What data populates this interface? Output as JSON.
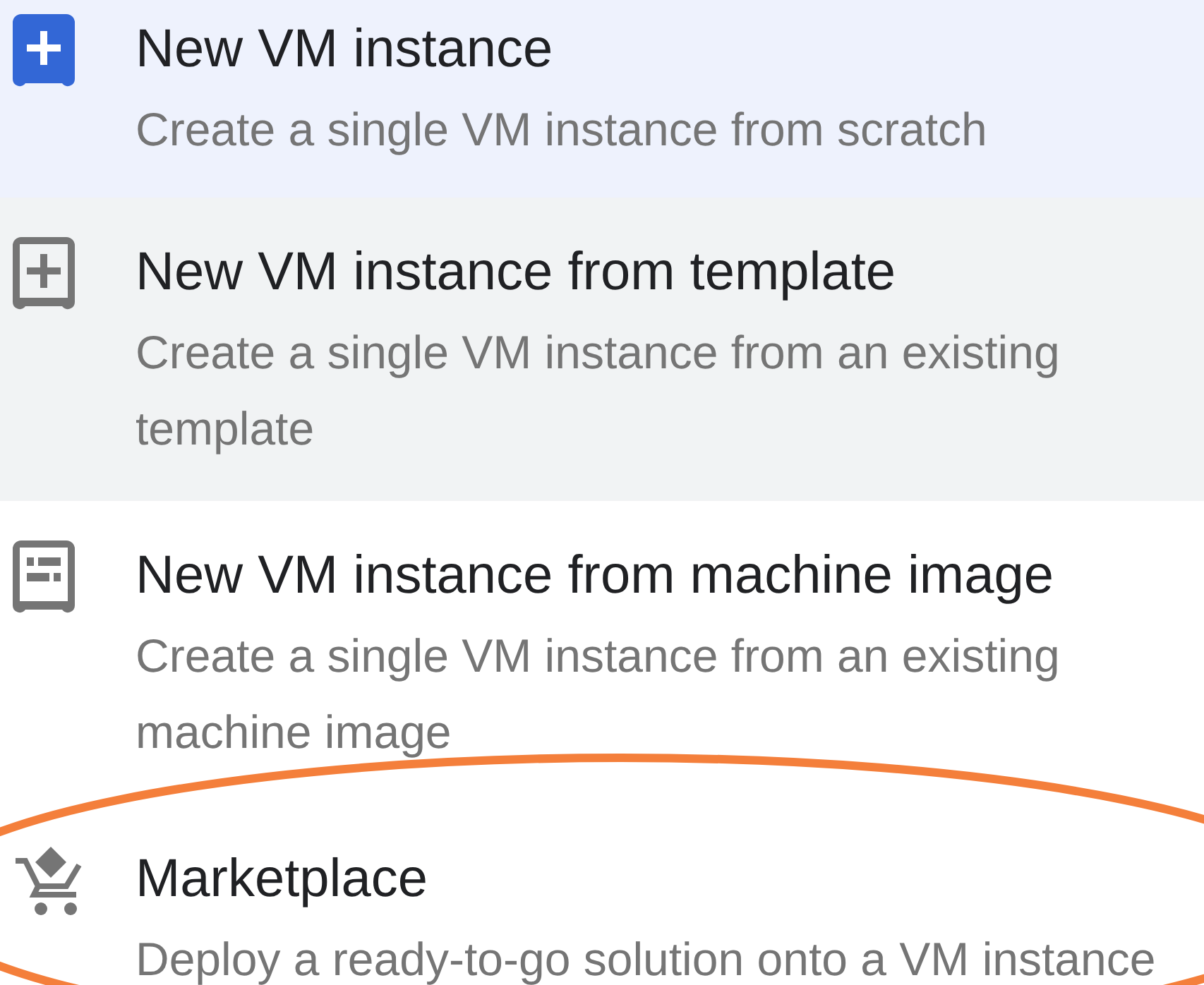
{
  "menu_items": [
    {
      "kind": "new",
      "title": "New VM instance",
      "description": "Create a single VM instance from scratch",
      "selected": true,
      "hovered": false
    },
    {
      "kind": "template",
      "title": "New VM instance from template",
      "description": "Create a single VM instance from an existing template",
      "selected": false,
      "hovered": true
    },
    {
      "kind": "machine_image",
      "title": "New VM instance from machine image",
      "description": "Create a single VM instance from an existing machine image",
      "selected": false,
      "hovered": false
    },
    {
      "kind": "marketplace",
      "title": "Marketplace",
      "description": "Deploy a ready-to-go solution onto a VM instance",
      "selected": false,
      "hovered": false
    }
  ],
  "annotation": {
    "kind": "ellipse",
    "color": "#f47f3b"
  }
}
